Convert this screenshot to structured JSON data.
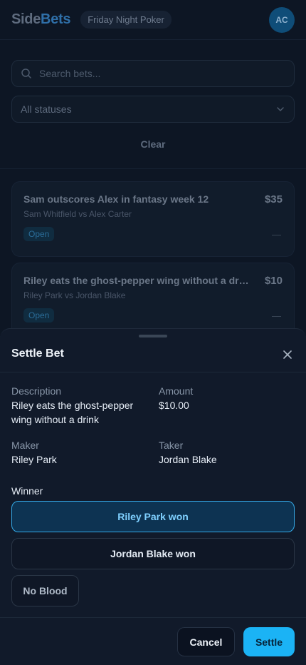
{
  "header": {
    "logo_part1": "Side",
    "logo_part2": "Bets",
    "group_name": "Friday Night Poker",
    "avatar_initials": "AC"
  },
  "filters": {
    "search_placeholder": "Search bets...",
    "status_selected": "All statuses",
    "clear_label": "Clear"
  },
  "bets": [
    {
      "title": "Sam outscores Alex in fantasy week 12",
      "parties": "Sam Whitfield vs Alex Carter",
      "amount": "$35",
      "status": "Open",
      "outcome": "—"
    },
    {
      "title": "Riley eats the ghost-pepper wing without a drink",
      "parties": "Riley Park vs Jordan Blake",
      "amount": "$10",
      "status": "Open",
      "outcome": "—"
    }
  ],
  "sheet": {
    "title": "Settle Bet",
    "description_label": "Description",
    "description_value": "Riley eats the ghost-pepper wing without a drink",
    "amount_label": "Amount",
    "amount_value": "$10.00",
    "maker_label": "Maker",
    "maker_value": "Riley Park",
    "taker_label": "Taker",
    "taker_value": "Jordan Blake",
    "winner_label": "Winner",
    "options": [
      "Riley Park won",
      "Jordan Blake won"
    ],
    "selected_option": "Riley Park won",
    "no_blood_label": "No Blood",
    "cancel_label": "Cancel",
    "settle_label": "Settle"
  },
  "colors": {
    "accent": "#1bb3f5",
    "background": "#0d1624",
    "sheet": "#111a2a"
  }
}
